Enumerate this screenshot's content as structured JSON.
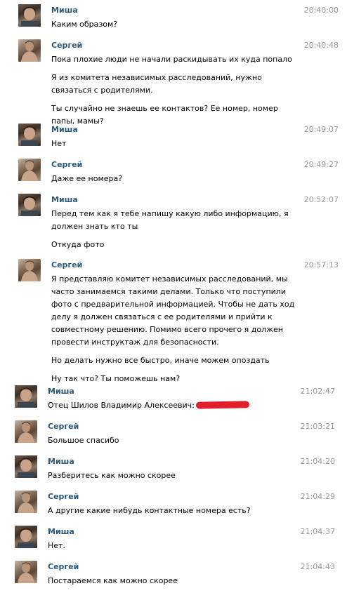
{
  "messages": [
    {
      "author": "Миша",
      "time": "20:40:00",
      "paragraphs": [
        "Каким образом?"
      ]
    },
    {
      "author": "Сергей",
      "time": "20:40:48",
      "paragraphs": [
        "Пока плохие люди не начали раскидывать их куда попало",
        "Я из комитета независимых расследований, нужно связаться с родителями.",
        "Ты случайно не знаешь ее контактов? Ее номер, номер папы, мамы?"
      ]
    },
    {
      "author": "Миша",
      "time": "20:49:07",
      "paragraphs": [
        "Нет"
      ]
    },
    {
      "author": "Сергей",
      "time": "20:49:27",
      "paragraphs": [
        "Даже ее номера?"
      ]
    },
    {
      "author": "Миша",
      "time": "20:52:07",
      "paragraphs": [
        "Перед тем как я тебе напишу какую либо информацию, я должен знать кто ты",
        "Откуда фото"
      ]
    },
    {
      "author": "Сергей",
      "time": "20:57:13",
      "paragraphs": [
        "Я представляю комитет независимых расследований, мы часто занимаемся такими делами. Только что поступили фото с предварительной информацией. Чтобы не дать ход делу я должен связаться с ее родителями и прийти к совместному решению. Помимо всего прочего я должен провести инструктаж для безопасности.",
        "Но делать нужно все быстро, иначе можем опоздать",
        "Ну так что? Ты поможешь нам?"
      ]
    },
    {
      "author": "Миша",
      "time": "21:02:47",
      "paragraphs": [
        "Отец Шилов Владимир Алексеевич:"
      ]
    },
    {
      "author": "Сергей",
      "time": "21:03:21",
      "paragraphs": [
        "Большое спасибо"
      ]
    },
    {
      "author": "Миша",
      "time": "21:04:20",
      "paragraphs": [
        "Разберитесь как можно скорее"
      ]
    },
    {
      "author": "Сергей",
      "time": "21:04:29",
      "paragraphs": [
        "А другие какие нибудь контактные номера есть?"
      ]
    },
    {
      "author": "Миша",
      "time": "21:04:37",
      "paragraphs": [
        "Нет."
      ]
    },
    {
      "author": "Сергей",
      "time": "21:04:43",
      "paragraphs": [
        "Постараемся как можно скорее"
      ]
    }
  ]
}
